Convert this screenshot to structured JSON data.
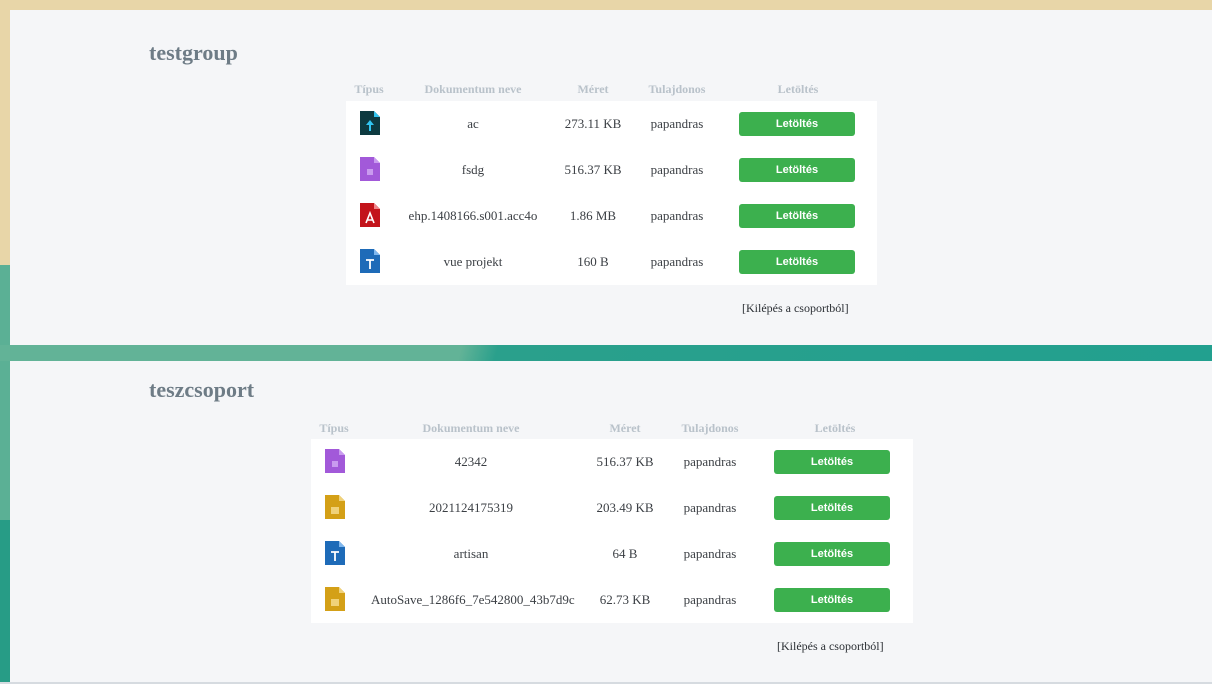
{
  "colors": {
    "accent_button": "#3cb04e",
    "icon_ai": "#0d3a40",
    "icon_ai_tip": "#31c5f0",
    "icon_purple": "#a259d9",
    "icon_pdf": "#c3141b",
    "icon_word": "#1e6bb8",
    "icon_gold": "#d4a017"
  },
  "headers": {
    "type": "Típus",
    "name": "Dokumentum neve",
    "size": "Méret",
    "owner": "Tulajdonos",
    "download": "Letöltés"
  },
  "groups": [
    {
      "title": "testgroup",
      "leave_label": "[Kilépés a csoportból]",
      "rows": [
        {
          "icon": "ai-file-icon",
          "name": "ac",
          "size": "273.11 KB",
          "owner": "papandras",
          "button": "Letöltés"
        },
        {
          "icon": "purple-file-icon",
          "name": "fsdg",
          "size": "516.37 KB",
          "owner": "papandras",
          "button": "Letöltés"
        },
        {
          "icon": "pdf-file-icon",
          "name": "ehp.1408166.s001.acc4o",
          "size": "1.86 MB",
          "owner": "papandras",
          "button": "Letöltés"
        },
        {
          "icon": "word-file-icon",
          "name": "vue projekt",
          "size": "160 B",
          "owner": "papandras",
          "button": "Letöltés"
        }
      ]
    },
    {
      "title": "teszcsoport",
      "leave_label": "[Kilépés a csoportból]",
      "rows": [
        {
          "icon": "purple-file-icon",
          "name": "42342",
          "size": "516.37 KB",
          "owner": "papandras",
          "button": "Letöltés"
        },
        {
          "icon": "image-file-icon",
          "name": "2021124175319",
          "size": "203.49 KB",
          "owner": "papandras",
          "button": "Letöltés"
        },
        {
          "icon": "word-file-icon",
          "name": "artisan",
          "size": "64 B",
          "owner": "papandras",
          "button": "Letöltés"
        },
        {
          "icon": "image-file-icon",
          "name": "AutoSave_1286f6_7e542800_43b7d9c",
          "size": "62.73 KB",
          "owner": "papandras",
          "button": "Letöltés"
        }
      ]
    }
  ]
}
